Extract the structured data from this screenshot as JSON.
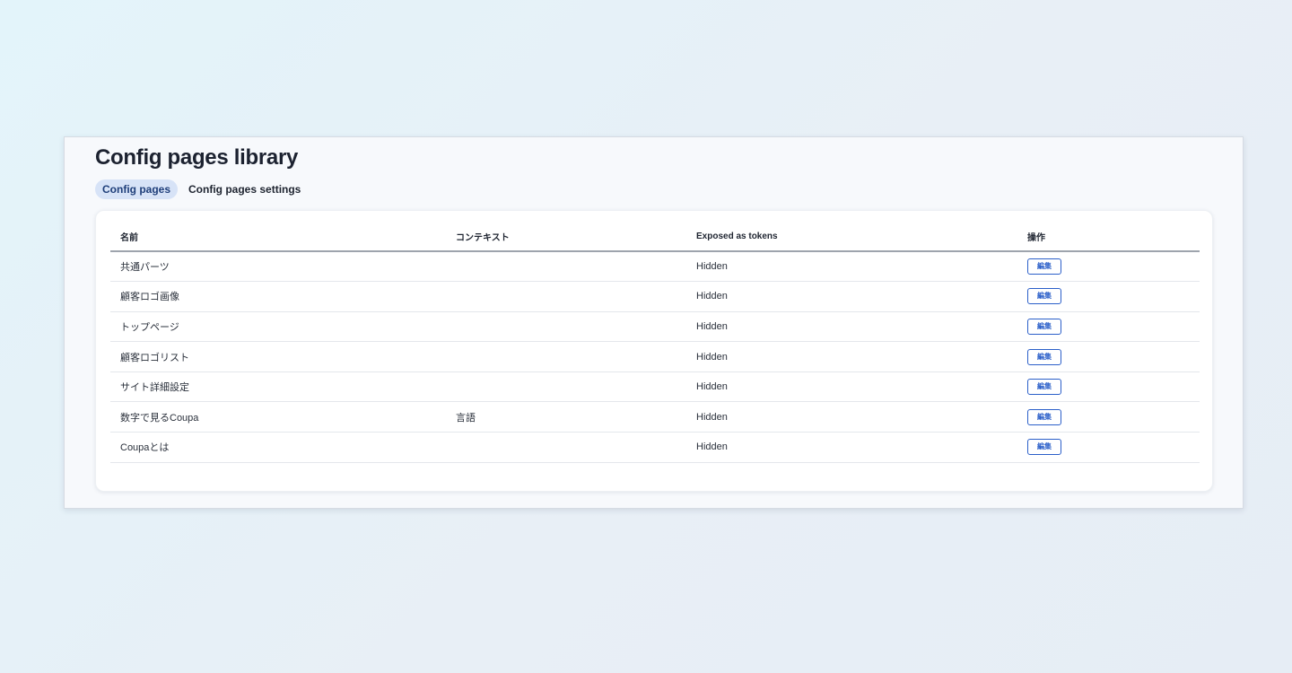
{
  "page": {
    "title": "Config pages library"
  },
  "tabs": [
    {
      "label": "Config pages",
      "active": true
    },
    {
      "label": "Config pages settings",
      "active": false
    }
  ],
  "table": {
    "headers": {
      "name": "名前",
      "context": "コンテキスト",
      "tokens": "Exposed as tokens",
      "actions": "操作"
    },
    "rows": [
      {
        "name": "共通パーツ",
        "context": "",
        "tokens": "Hidden",
        "action": "編集"
      },
      {
        "name": "顧客ロゴ画像",
        "context": "",
        "tokens": "Hidden",
        "action": "編集"
      },
      {
        "name": "トップページ",
        "context": "",
        "tokens": "Hidden",
        "action": "編集"
      },
      {
        "name": "顧客ロゴリスト",
        "context": "",
        "tokens": "Hidden",
        "action": "編集"
      },
      {
        "name": "サイト詳細設定",
        "context": "",
        "tokens": "Hidden",
        "action": "編集"
      },
      {
        "name": "数字で見るCoupa",
        "context": "言語",
        "tokens": "Hidden",
        "action": "編集"
      },
      {
        "name": "Coupaとは",
        "context": "",
        "tokens": "Hidden",
        "action": "編集"
      }
    ]
  },
  "colors": {
    "accent": "#2b5fc9",
    "active_tab_bg": "#d7e3f7"
  }
}
